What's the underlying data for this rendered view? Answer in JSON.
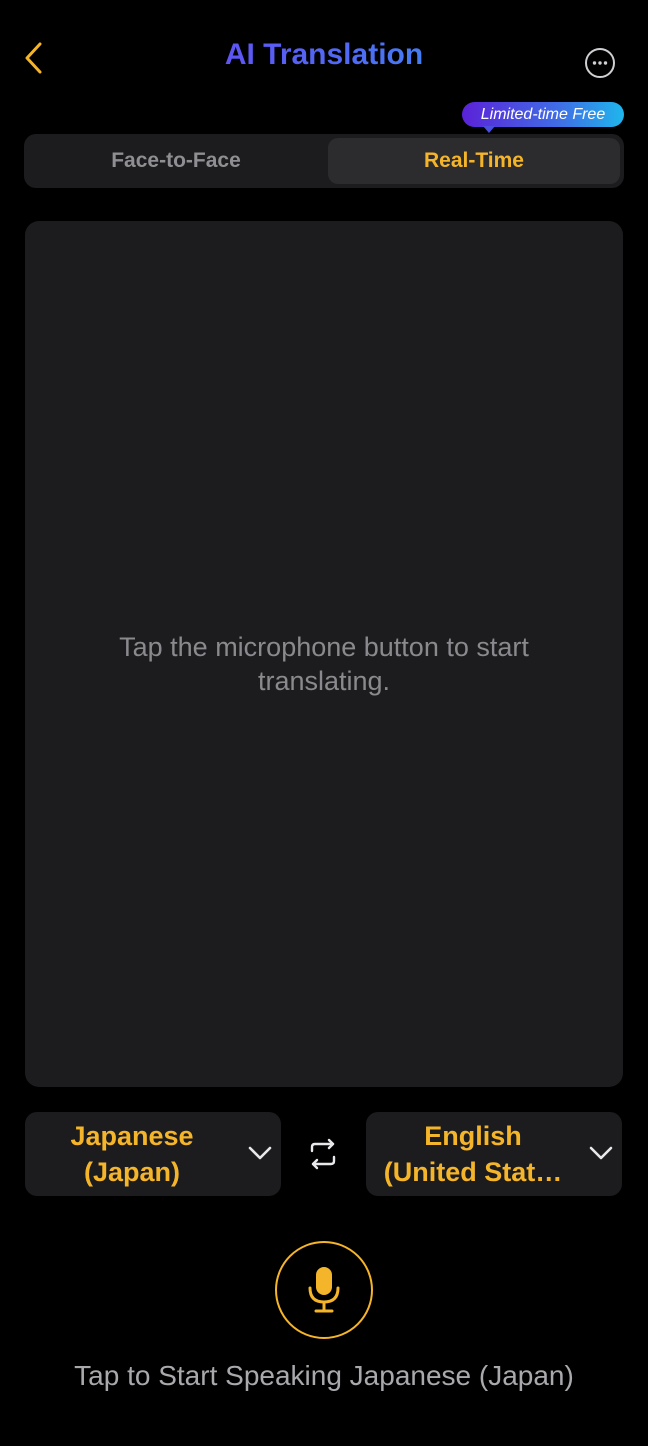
{
  "header": {
    "title": "AI Translation",
    "back_icon": "chevron-left-icon",
    "more_icon": "more-horizontal-circle-icon"
  },
  "badge": {
    "label": "Limited-time Free"
  },
  "tabs": [
    {
      "label": "Face-to-Face",
      "selected": false
    },
    {
      "label": "Real-Time",
      "selected": true
    }
  ],
  "panel": {
    "hint": "Tap the microphone button to start translating."
  },
  "languages": {
    "source": {
      "label": "Japanese (Japan)"
    },
    "target": {
      "label": "English (United Stat…"
    },
    "swap_icon": "swap-arrows-icon",
    "dropdown_icon": "chevron-down-icon"
  },
  "mic": {
    "icon": "microphone-icon",
    "prompt": "Tap to Start Speaking Japanese (Japan)"
  },
  "colors": {
    "accent": "#f5b52a",
    "background": "#000000",
    "surface": "#1c1c1e",
    "title_gradient_start": "#7b2cf0",
    "title_gradient_end": "#1fb6f0",
    "back_icon": "#f5b52a"
  }
}
